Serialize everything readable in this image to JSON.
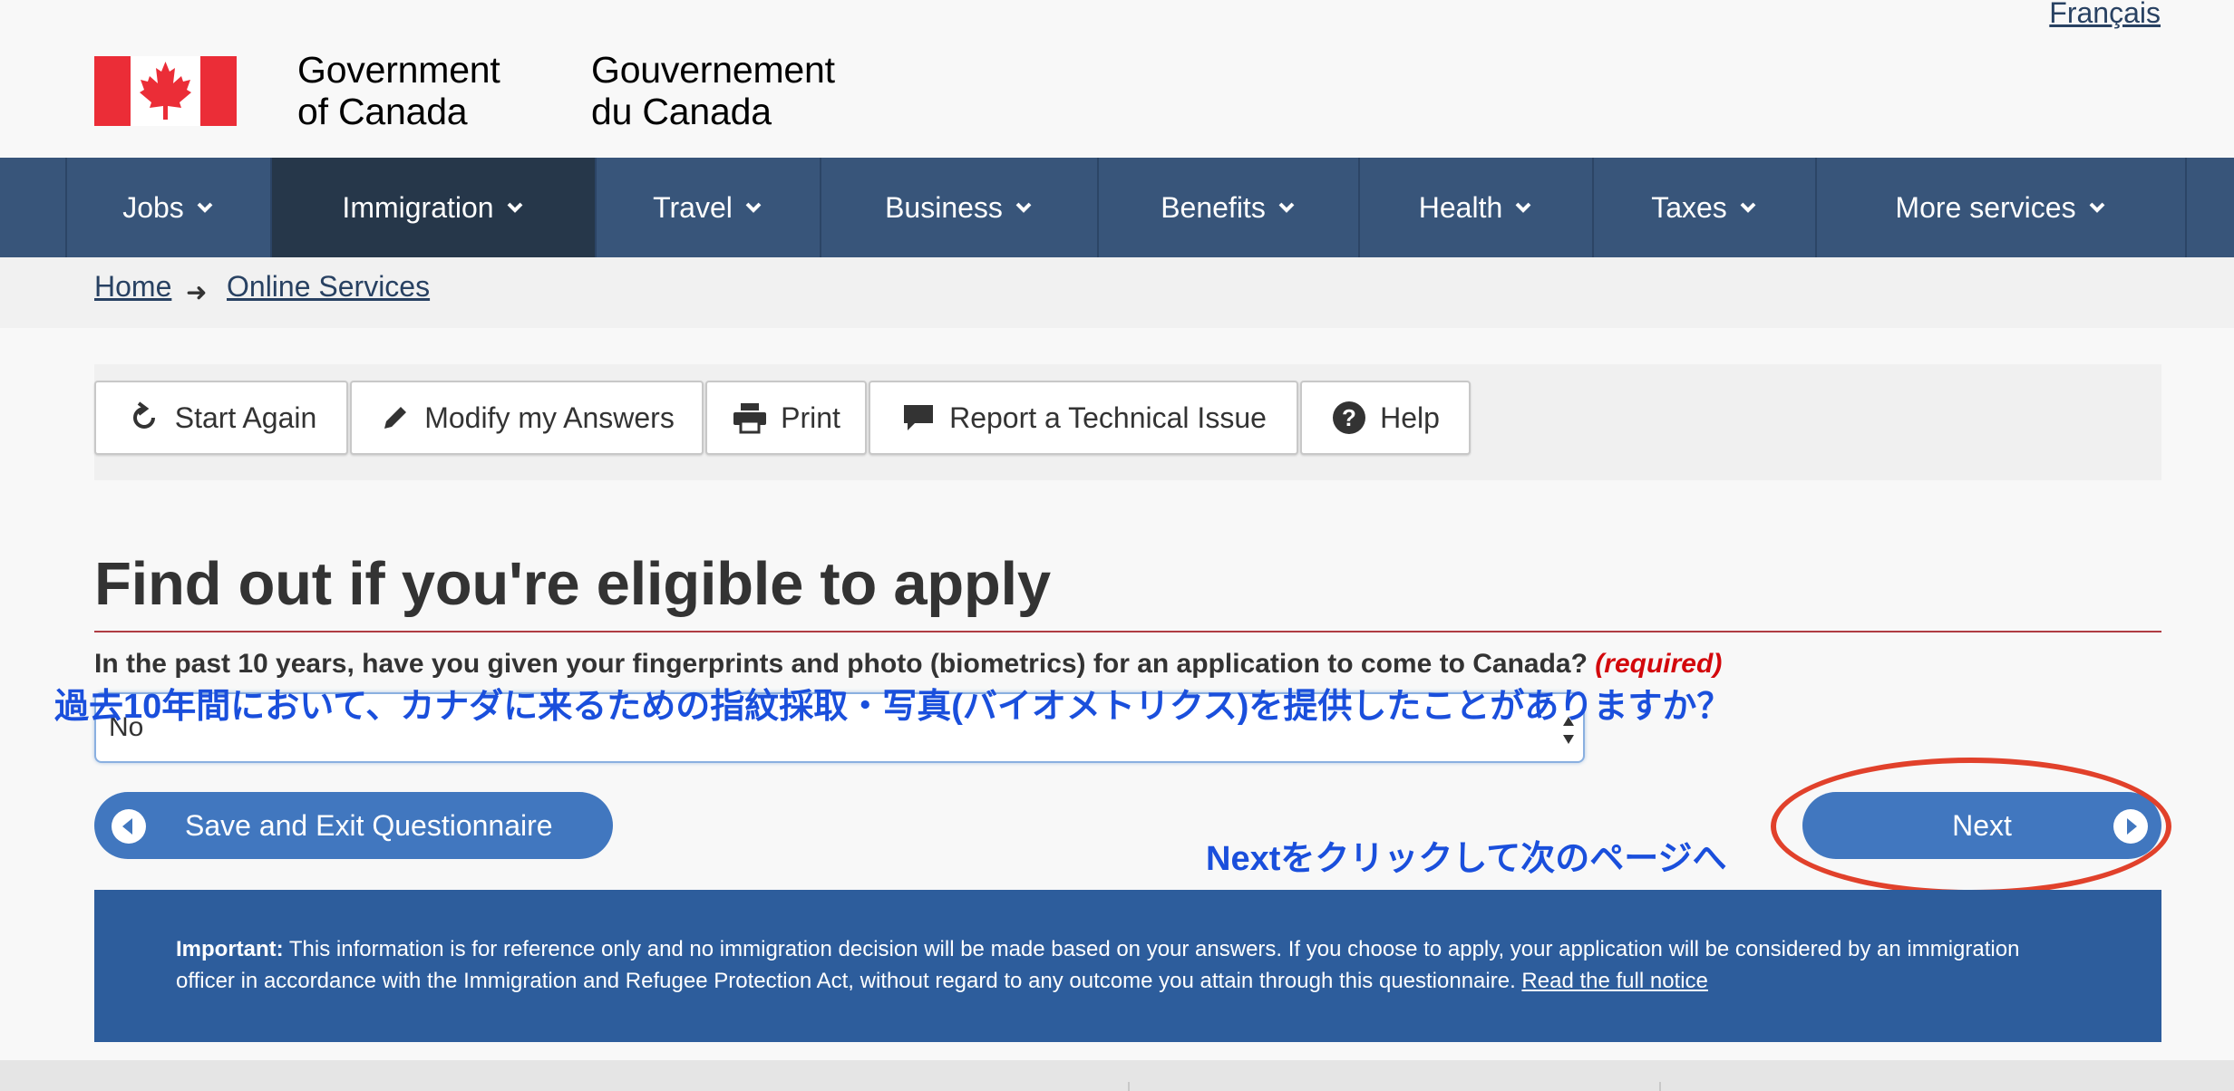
{
  "header": {
    "lang_link": "Français",
    "sig_en_line1": "Government",
    "sig_en_line2": "of Canada",
    "sig_fr_line1": "Gouvernement",
    "sig_fr_line2": "du Canada",
    "flag_colors": {
      "red": "#eb2d37",
      "white": "#ffffff"
    }
  },
  "nav": {
    "items": [
      {
        "label": "Jobs"
      },
      {
        "label": "Immigration",
        "active": true
      },
      {
        "label": "Travel"
      },
      {
        "label": "Business"
      },
      {
        "label": "Benefits"
      },
      {
        "label": "Health"
      },
      {
        "label": "Taxes"
      },
      {
        "label": "More services"
      }
    ]
  },
  "breadcrumb": {
    "items": [
      "Home",
      "Online Services"
    ],
    "separator_icon": "arrow-right-icon"
  },
  "toolbar": {
    "start_again": "Start Again",
    "modify": "Modify my Answers",
    "print": "Print",
    "report": "Report a Technical Issue",
    "help": "Help"
  },
  "main": {
    "title": "Find out if you're eligible to apply",
    "question": "In the past 10 years, have you given your fingerprints and photo (biometrics) for an application to come to Canada?",
    "required": "(required)",
    "select_value": "No",
    "annotation_jp": "過去10年間において、カナダに来るための指紋採取・写真(バイオメトリクス)を提供したことがありますか？"
  },
  "actions": {
    "save_exit": "Save and Exit Questionnaire",
    "next": "Next",
    "next_annotation": "Nextをクリックして次のページへ"
  },
  "notice": {
    "label": "Important:",
    "text": " This information is for reference only and no immigration decision will be made based on your answers. If you choose to apply, your application will be considered by an immigration officer in accordance with the Immigration and Refugee Protection Act, without regard to any outcome you attain through this questionnaire. ",
    "link": "Read the full notice"
  },
  "colors": {
    "nav_bg": "#38557a",
    "nav_active": "#26374a",
    "button_blue": "#4177bf",
    "notice_bg": "#2d5d9c",
    "annotation_blue": "#1a4fdc",
    "annotation_red": "#e1412b",
    "title_rule": "#af3c43"
  }
}
